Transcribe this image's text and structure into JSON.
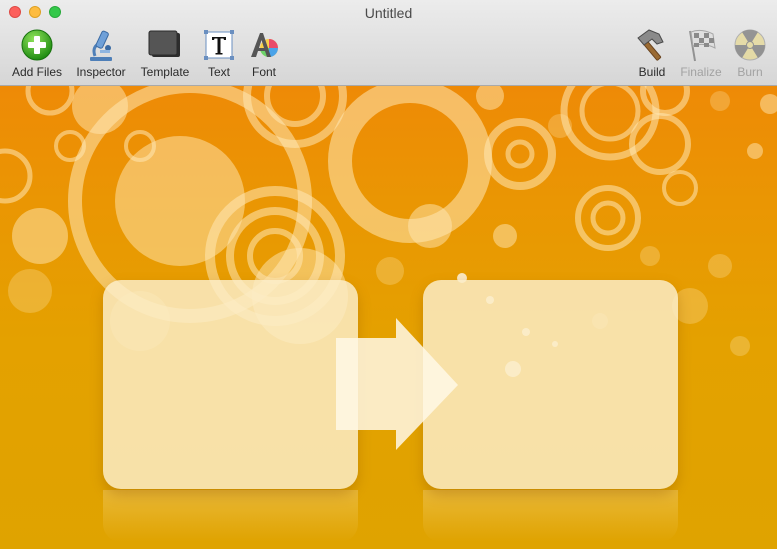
{
  "window": {
    "title": "Untitled"
  },
  "toolbar": {
    "left": [
      {
        "label": "Add Files",
        "icon": "add-files-icon"
      },
      {
        "label": "Inspector",
        "icon": "microscope-icon"
      },
      {
        "label": "Template",
        "icon": "template-icon"
      },
      {
        "label": "Text",
        "icon": "text-icon"
      },
      {
        "label": "Font",
        "icon": "font-icon"
      }
    ],
    "right": [
      {
        "label": "Build",
        "icon": "hammer-icon",
        "enabled": true
      },
      {
        "label": "Finalize",
        "icon": "checkered-flag-icon",
        "enabled": false
      },
      {
        "label": "Burn",
        "icon": "radiation-icon",
        "enabled": false
      }
    ]
  },
  "colors": {
    "background_top": "#ee8a06",
    "background_bottom": "#dfa300",
    "dropzone": "#fcedc8"
  }
}
